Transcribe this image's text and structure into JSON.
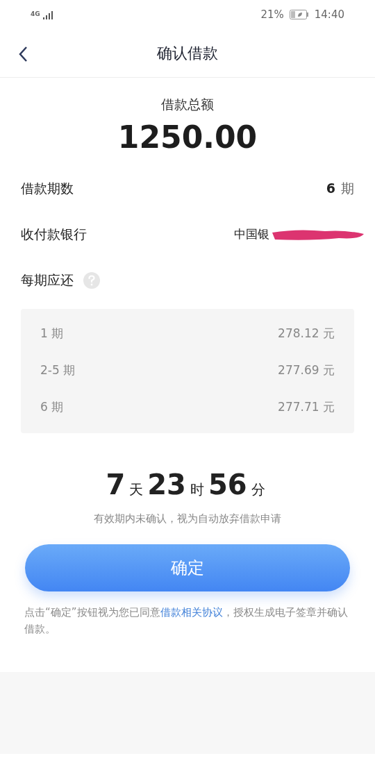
{
  "status_bar": {
    "network": "4G",
    "battery": "21%",
    "time": "14:40"
  },
  "header": {
    "title": "确认借款"
  },
  "amount": {
    "label": "借款总额",
    "value": "1250.00"
  },
  "rows": [
    {
      "kind": "terms",
      "label": "借款期数",
      "value": "6",
      "unit": "期"
    },
    {
      "kind": "bank",
      "label": "收付款银行",
      "value": "中国银"
    },
    {
      "kind": "help",
      "label": "每期应还"
    }
  ],
  "schedule": [
    {
      "period": "1 期",
      "amount": "278.12 元"
    },
    {
      "period": "2-5 期",
      "amount": "277.69 元"
    },
    {
      "period": "6 期",
      "amount": "277.71 元"
    }
  ],
  "countdown": {
    "parts": [
      {
        "number": "7",
        "unit": "天"
      },
      {
        "number": "23",
        "unit": "时"
      },
      {
        "number": "56",
        "unit": "分"
      }
    ],
    "note": "有效期内未确认，视为自动放弃借款申请"
  },
  "confirm_button": "确定",
  "agreement": {
    "before": "点击“确定”按钮视为您已同意",
    "link": "借款相关协议",
    "after": "，授权生成电子签章并确认借款。"
  }
}
